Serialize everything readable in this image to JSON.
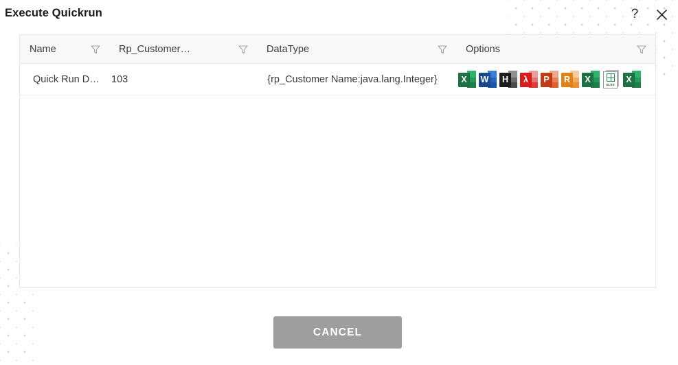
{
  "dialog": {
    "title": "Execute Quickrun",
    "help_icon": "question-mark-icon",
    "close_icon": "close-icon"
  },
  "table": {
    "filter_icon": "filter-funnel-icon",
    "columns": [
      {
        "key": "name",
        "label": "Name"
      },
      {
        "key": "param",
        "label": "Rp_Customer…"
      },
      {
        "key": "type",
        "label": "DataType"
      },
      {
        "key": "options",
        "label": "Options"
      }
    ],
    "rows": [
      {
        "name": "Quick Run D…",
        "param": "103",
        "type": "{rp_Customer Name:java.lang.Integer}"
      }
    ],
    "option_icons": [
      {
        "name": "export-excel-icon",
        "letter": "X",
        "body": "#1d7044",
        "light": "#2fb36a",
        "mid": "#249a59",
        "dark": "#1d8049"
      },
      {
        "name": "export-word-icon",
        "letter": "W",
        "body": "#17478f",
        "light": "#3a7fdc",
        "mid": "#2566c0",
        "dark": "#1c56a8"
      },
      {
        "name": "export-html-icon",
        "letter": "H",
        "body": "#1d1d1d",
        "light": "#8f8f8f",
        "mid": "#6d6d6d",
        "dark": "#4a4a4a"
      },
      {
        "name": "export-pdf-icon",
        "letter": "λ",
        "body": "#d81c1c",
        "light": "#ef9c9c",
        "mid": "#ea7272",
        "dark": "#e03c3c"
      },
      {
        "name": "export-powerpoint-icon",
        "letter": "P",
        "body": "#c23b16",
        "light": "#f0a98e",
        "mid": "#eb7f56",
        "dark": "#e25f30"
      },
      {
        "name": "export-rtf-icon",
        "letter": "R",
        "body": "#e28214",
        "light": "#f6cda0",
        "mid": "#f2ab61",
        "dark": "#ed9130"
      },
      {
        "name": "export-xls-icon",
        "letter": "X",
        "body": "#1d7044",
        "light": "#2fb36a",
        "mid": "#249a59",
        "dark": "#1d8049"
      },
      {
        "name": "export-xlsx-file-icon",
        "letter": "",
        "doc": true,
        "doc_label": "XLSX"
      },
      {
        "name": "export-csv-icon",
        "letter": "X",
        "body": "#1d7044",
        "light": "#2fb36a",
        "mid": "#249a59",
        "dark": "#1d8049"
      }
    ]
  },
  "footer": {
    "cancel_label": "CANCEL"
  },
  "colors": {
    "button_gray": "#9e9e9e",
    "header_bg": "#f8f8f8",
    "dot_pattern": "#c9d2f0"
  }
}
